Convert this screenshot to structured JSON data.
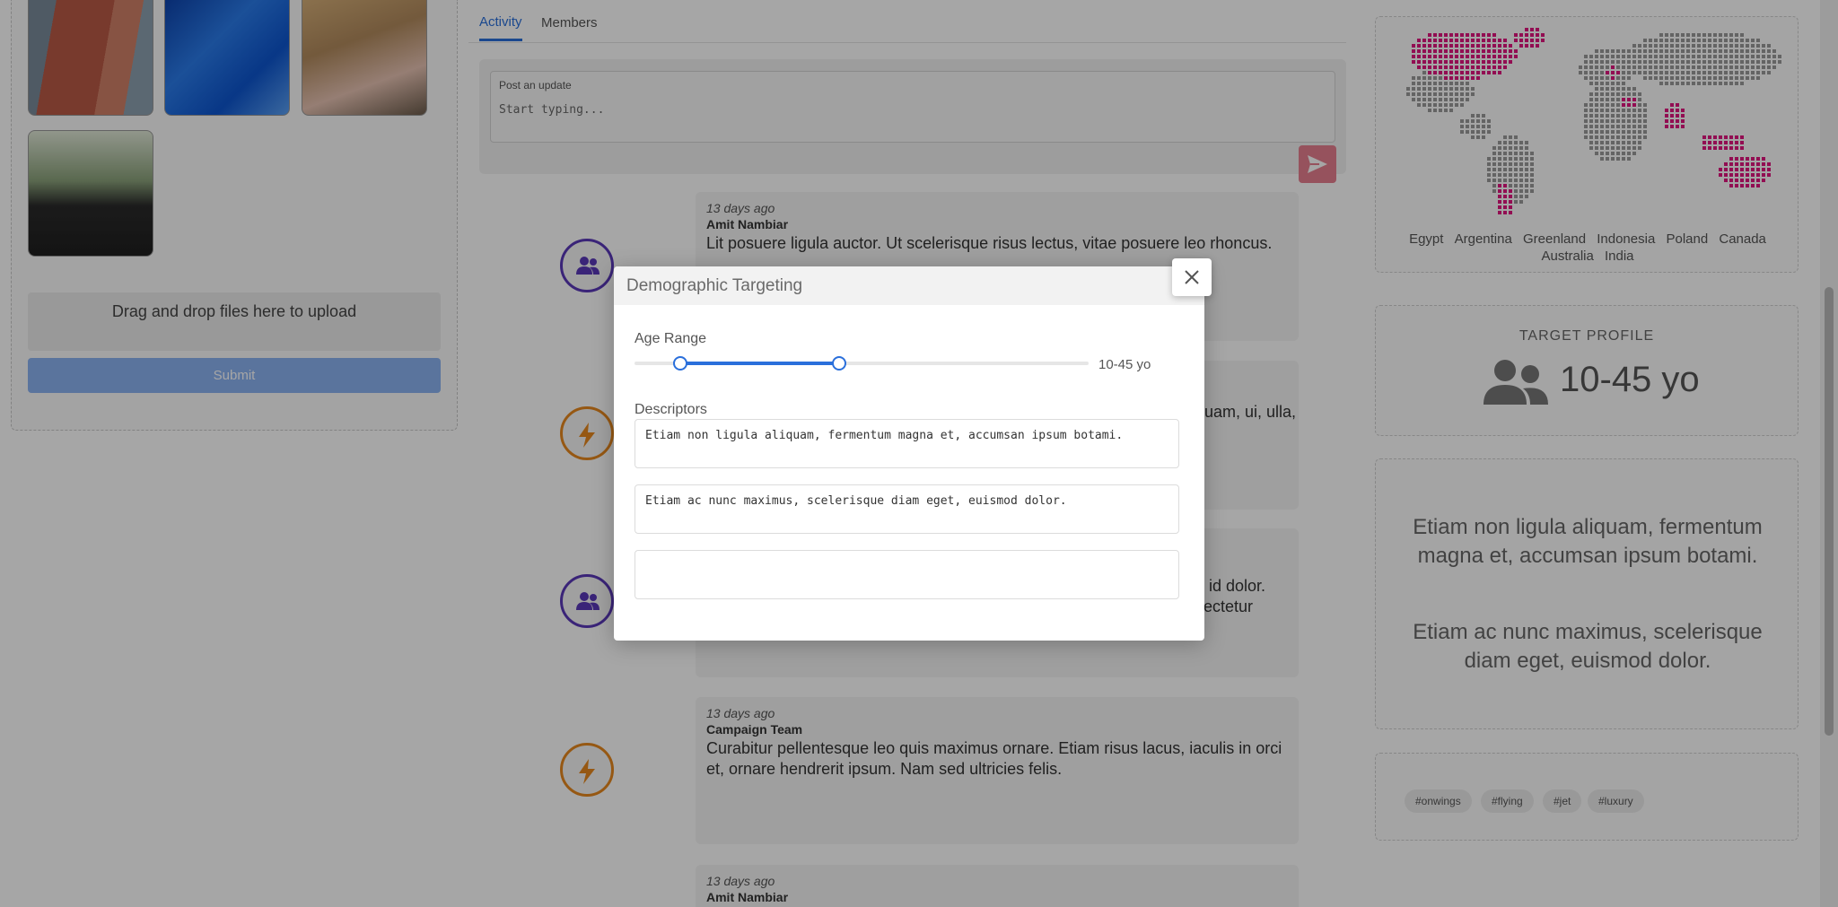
{
  "left_panel": {
    "photos": [
      "tower-photo",
      "blue-stairs-photo",
      "two-women-photo",
      "woman-sunglasses-photo"
    ],
    "dropzone_text": "Drag and drop files here to upload",
    "submit_label": "Submit"
  },
  "tabs": [
    {
      "label": "Activity",
      "active": true
    },
    {
      "label": "Members",
      "active": false
    }
  ],
  "post": {
    "label": "Post an update",
    "placeholder": "Start typing..."
  },
  "feed": [
    {
      "date": "13 days ago",
      "author": "Amit Nambiar",
      "body": "Lit posuere ligula auctor. Ut scelerisque risus lectus, vitae posuere leo rhoncus.",
      "icon": "people-icon"
    },
    {
      "date": "",
      "author": "",
      "body": "uam, ui, ulla,",
      "icon": "bolt-icon"
    },
    {
      "date": "",
      "author": "",
      "body": "n id dolor. sectetur",
      "icon": "people-icon"
    },
    {
      "date": "13 days ago",
      "author": "Campaign Team",
      "body": "Curabitur pellentesque leo quis maximus ornare. Etiam risus lacus, iaculis in orci et, ornare hendrerit ipsum. Nam sed ultricies felis.",
      "icon": "bolt-icon"
    },
    {
      "date": "13 days ago",
      "author": "Amit Nambiar",
      "body": "",
      "icon": "people-icon"
    }
  ],
  "map": {
    "countries": [
      "Egypt",
      "Argentina",
      "Greenland",
      "Indonesia",
      "Poland",
      "Canada",
      "Australia",
      "India"
    ],
    "highlight_color": "#e0157f",
    "base_color": "#9a9a9a"
  },
  "profile": {
    "title": "TARGET PROFILE",
    "value": "10-45 yo",
    "icon": "users-icon"
  },
  "descriptors_preview": [
    "Etiam non ligula aliquam, fermentum magna et, accumsan ipsum botami.",
    "Etiam ac nunc maximus, scelerisque diam eget, euismod dolor."
  ],
  "tags": [
    "#onwings",
    "#flying",
    "#jet",
    "#luxury"
  ],
  "modal": {
    "title": "Demographic Targeting",
    "age_label": "Age Range",
    "age_min_pct": 0.1,
    "age_max_pct": 0.45,
    "age_value": "10-45 yo",
    "descriptors_label": "Descriptors",
    "descriptors": [
      "Etiam non ligula aliquam, fermentum magna et, accumsan ipsum botami.",
      "Etiam ac nunc maximus, scelerisque diam eget, euismod dolor.",
      ""
    ]
  },
  "colors": {
    "accent": "#2a6fdb",
    "people_icon": "#5a38b8",
    "bolt_icon": "#e6881e",
    "send_button": "#e67f8f"
  }
}
